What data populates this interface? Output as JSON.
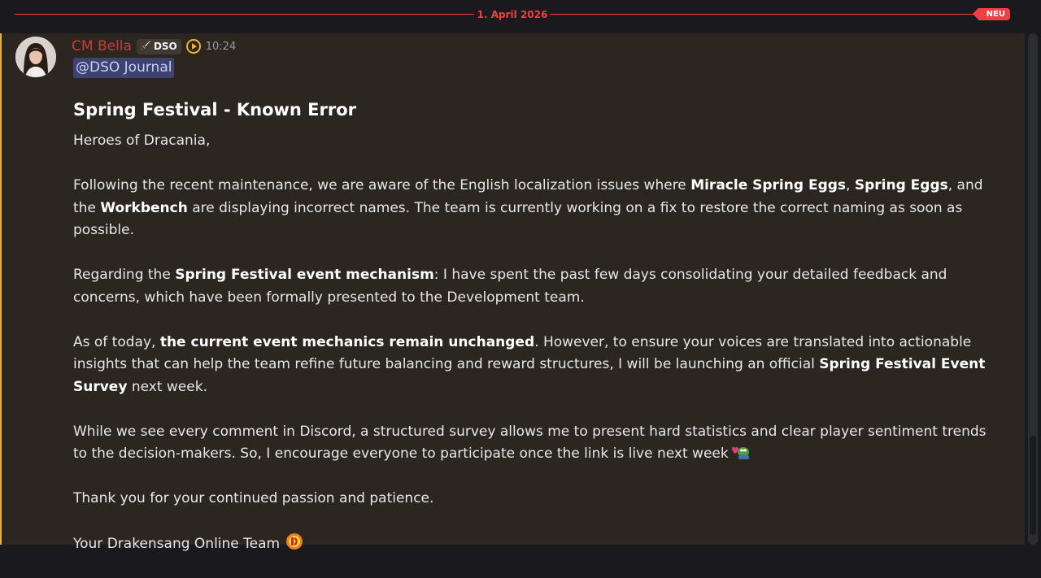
{
  "divider": {
    "date": "1. April 2026",
    "badge": "NEU"
  },
  "message": {
    "author": "CM Bella",
    "role_tag": "DSO",
    "role_icon": "sword-icon",
    "boost_icon": "server-boost-icon",
    "timestamp": "10:24",
    "mention": "@DSO Journal",
    "title": "Spring Festival - Known Error",
    "greeting": "Heroes of Dracania,",
    "p1": {
      "a": "Following the recent maintenance, we are aware of the English localization issues where ",
      "b1": "Miracle Spring Eggs",
      "c": ", ",
      "b2": "Spring Eggs",
      "d": ", and the ",
      "b3": "Workbench",
      "e": " are displaying incorrect names. The team is currently working on a fix to restore the correct naming as soon as possible."
    },
    "p2": {
      "a": "Regarding the ",
      "b1": "Spring Festival event mechanism",
      "c": ": I have spent the past few days consolidating your detailed feedback and concerns, which have been formally presented to the Development team."
    },
    "p3": {
      "a": "As of today, ",
      "b1": "the current event mechanics remain unchanged",
      "c": ". However, to ensure your voices are translated into actionable insights that can help the team refine future balancing and reward structures, I will be launching an official ",
      "b2": "Spring Festival Event Survey",
      "d": " next week."
    },
    "p4": "While we see every comment in Discord, a structured survey allows me to present hard statistics and clear player sentiment trends to the decision-makers. So, I encourage everyone to participate once the link is live next week",
    "p4_emoji": "pepe-love-emoji",
    "p5": "Thank you for your continued passion and patience.",
    "signature": "Your Drakensang Online Team",
    "signature_emoji": "dso-logo-emoji"
  },
  "colors": {
    "accent_red": "#f23f43",
    "author_color": "#c3403a",
    "highlight_border": "#f0b232",
    "mention_bg": "#3e4270",
    "message_bg": "#2b2620"
  }
}
